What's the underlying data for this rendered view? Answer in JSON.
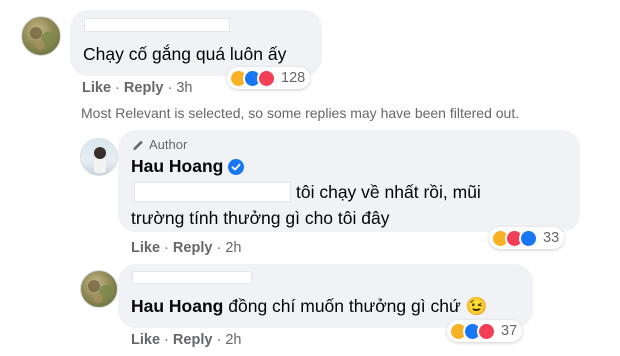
{
  "comments": {
    "top": {
      "text": "Chạy cố gắng quá luôn ấy",
      "actions": {
        "like": "Like",
        "reply": "Reply",
        "sep": "·",
        "time": "3h"
      },
      "reactions": {
        "icons": [
          "haha",
          "like",
          "love"
        ],
        "count": "128"
      }
    },
    "filter_note": "Most Relevant is selected, so some replies may have been filtered out.",
    "reply1": {
      "author_badge": "Author",
      "author_name": "Hau Hoang",
      "text_line1": "tôi chạy về nhất rồi, mũi",
      "text_line2": "trường tính thưởng gì cho tôi đây",
      "actions": {
        "like": "Like",
        "reply": "Reply",
        "sep": "·",
        "time": "2h"
      },
      "reactions": {
        "icons": [
          "haha",
          "love",
          "like"
        ],
        "count": "33"
      }
    },
    "reply2": {
      "mention": "Hau Hoang",
      "text": "đồng chí muốn thưởng gì chứ",
      "emoji": "😉",
      "actions": {
        "like": "Like",
        "reply": "Reply",
        "sep": "·",
        "time": "2h"
      },
      "reactions": {
        "icons": [
          "haha",
          "like",
          "love"
        ],
        "count": "37"
      }
    }
  },
  "colors": {
    "bubble": "#f0f2f5",
    "secondary_text": "#65676b",
    "like_blue": "#1877f2",
    "love_red": "#f33e58",
    "haha_yellow": "#f7b125",
    "verified_blue": "#1877f2"
  }
}
